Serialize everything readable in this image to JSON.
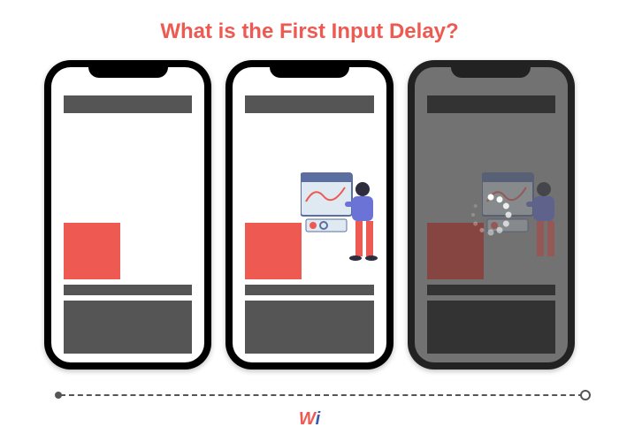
{
  "title": "What is the First Input Delay?",
  "phones": {
    "stage1": {
      "hasIllustration": false,
      "hasOverlay": false
    },
    "stage2": {
      "hasIllustration": true,
      "hasOverlay": false
    },
    "stage3": {
      "hasIllustration": true,
      "hasOverlay": true
    }
  },
  "colors": {
    "accent": "#ee5a52",
    "placeholder": "#555",
    "logo_blue": "#3c5aa6"
  },
  "logo": {
    "part1": "W",
    "part2": "i"
  }
}
